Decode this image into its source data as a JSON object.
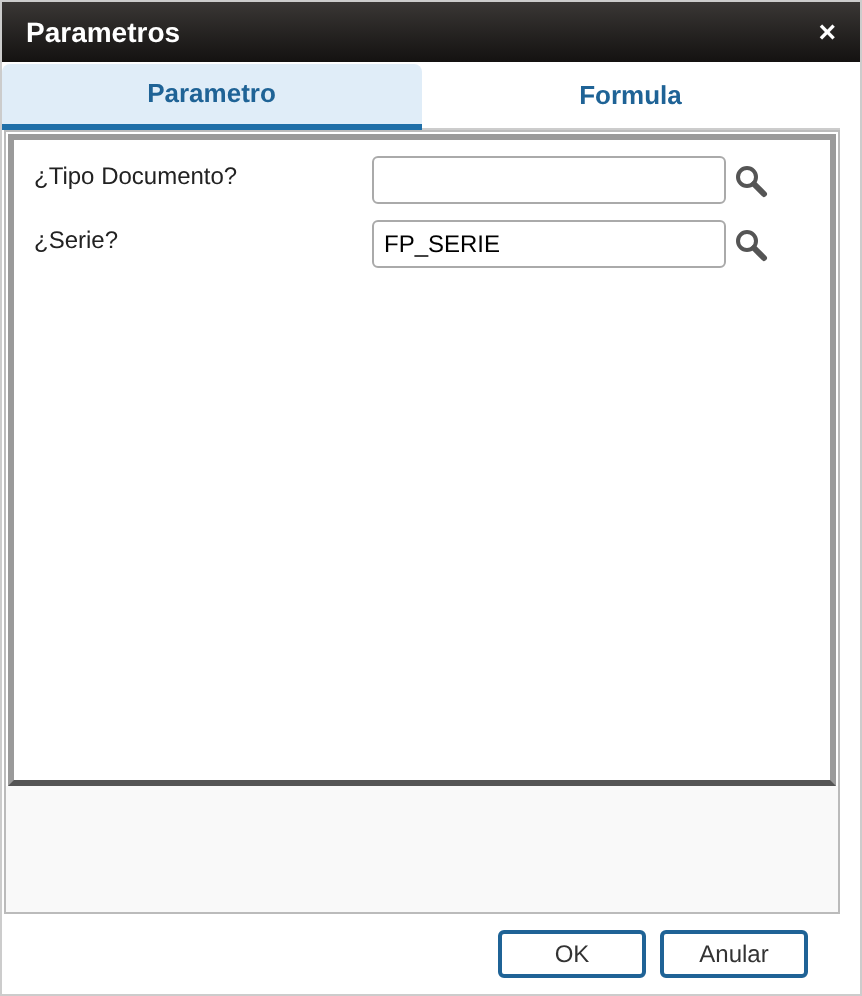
{
  "window": {
    "title": "Parametros",
    "close": "×"
  },
  "tabs": [
    {
      "label": "Parametro",
      "selected": true
    },
    {
      "label": "Formula",
      "selected": false
    }
  ],
  "fields": [
    {
      "label": "¿Tipo Documento?"
    },
    {
      "label": "¿Serie?",
      "value": "FP_SERIE"
    }
  ],
  "buttons": [
    "OK",
    "Anular"
  ]
}
